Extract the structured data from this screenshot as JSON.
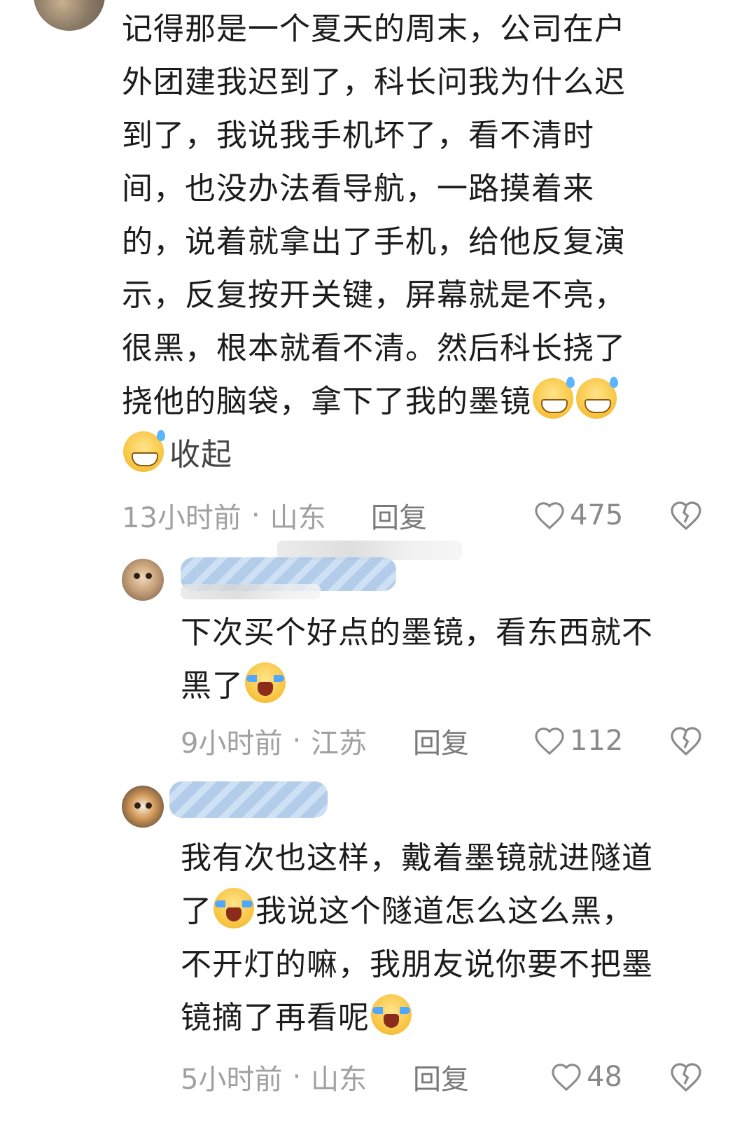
{
  "comments": [
    {
      "text_lines": [
        "记得那是一个夏天的周末，公司在户",
        "外团建我迟到了，科长问我为什么迟",
        "到了，我说我手机坏了，看不清时",
        "间，也没办法看导航，一路摸着来",
        "的，说着就拿出了手机，给他反复演",
        "示，反复按开关键，屏幕就是不亮，",
        "很黑，根本就看不清。然后科长挠了",
        "挠他的脑袋，拿下了我的墨镜"
      ],
      "emoji": "grinning-sweat-emoji",
      "collapse_label": "收起",
      "time": "13小时前",
      "location": "山东",
      "reply_label": "回复",
      "likes": "475"
    },
    {
      "text_line1": "下次买个好点的墨镜，看东西就不",
      "text_line2": "黑了",
      "emoji": "crying-face-emoji",
      "time": "9小时前",
      "location": "江苏",
      "reply_label": "回复",
      "likes": "112"
    },
    {
      "text_line1": "我有次也这样，戴着墨镜就进隧道",
      "text_line2a": "了",
      "text_line2b": "我说这个隧道怎么这么黑，",
      "text_line3": "不开灯的嘛，我朋友说你要不把墨",
      "text_line4": "镜摘了再看呢",
      "emoji": "crying-face-emoji",
      "time": "5小时前",
      "location": "山东",
      "reply_label": "回复",
      "likes": "48"
    }
  ],
  "meta_separator": "·",
  "colors": {
    "text": "#1c1c1c",
    "meta": "#a0a0a0",
    "reply": "#7a7a7a",
    "like": "#8a8a8a",
    "blur_name": "#a9c6e8"
  }
}
